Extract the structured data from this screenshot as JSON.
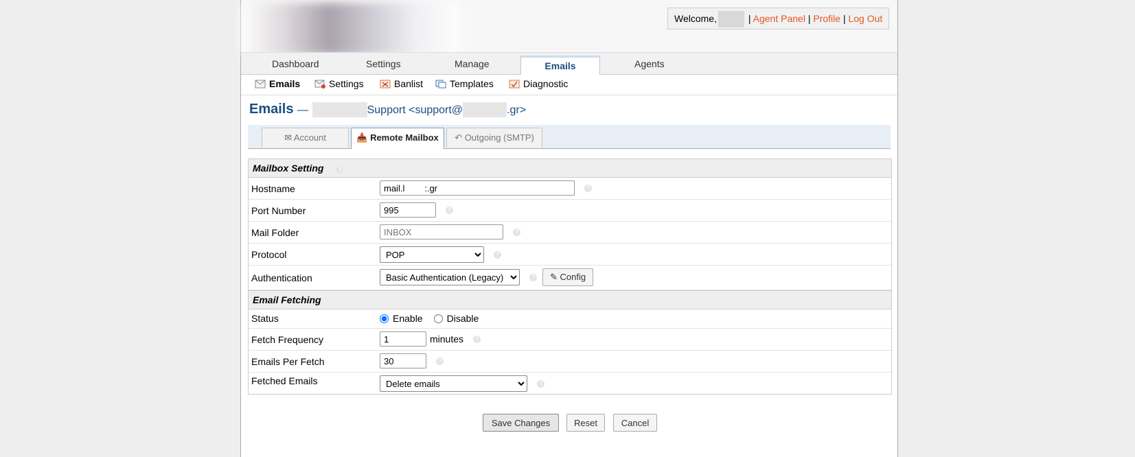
{
  "header": {
    "welcome": "Welcome,",
    "links": [
      "Agent Panel",
      "Profile",
      "Log Out"
    ],
    "separator": "|"
  },
  "nav": {
    "tabs": [
      "Dashboard",
      "Settings",
      "Manage",
      "Emails",
      "Agents"
    ],
    "active": "Emails"
  },
  "subnav": [
    {
      "label": "Emails",
      "icon": "envelope-icon",
      "bold": true
    },
    {
      "label": "Settings",
      "icon": "email-settings-icon"
    },
    {
      "label": "Banlist",
      "icon": "banlist-icon"
    },
    {
      "label": "Templates",
      "icon": "templates-icon"
    },
    {
      "label": "Diagnostic",
      "icon": "diagnostic-icon"
    }
  ],
  "page": {
    "title": "Emails",
    "dash": "—",
    "subtitle_mid": "Support <support@",
    "subtitle_end": ".gr>"
  },
  "tabs": [
    "Account",
    "Remote Mailbox",
    "Outgoing (SMTP)"
  ],
  "active_tab": "Remote Mailbox",
  "sections": {
    "mailbox": "Mailbox Setting",
    "fetching": "Email Fetching"
  },
  "fields": {
    "hostname": {
      "label": "Hostname",
      "value": "mail.l        :.gr"
    },
    "port": {
      "label": "Port Number",
      "value": "995"
    },
    "folder": {
      "label": "Mail Folder",
      "placeholder": "INBOX"
    },
    "protocol": {
      "label": "Protocol",
      "value": "POP"
    },
    "auth": {
      "label": "Authentication",
      "value": "Basic Authentication (Legacy)",
      "config_label": "Config"
    },
    "status": {
      "label": "Status",
      "enable": "Enable",
      "disable": "Disable"
    },
    "frequency": {
      "label": "Fetch Frequency",
      "value": "1",
      "unit": "minutes"
    },
    "per_fetch": {
      "label": "Emails Per Fetch",
      "value": "30"
    },
    "fetched": {
      "label": "Fetched Emails",
      "value": "Delete emails"
    }
  },
  "actions": {
    "save": "Save Changes",
    "reset": "Reset",
    "cancel": "Cancel"
  },
  "colors": {
    "link": "#e65524",
    "title": "#184e81"
  }
}
